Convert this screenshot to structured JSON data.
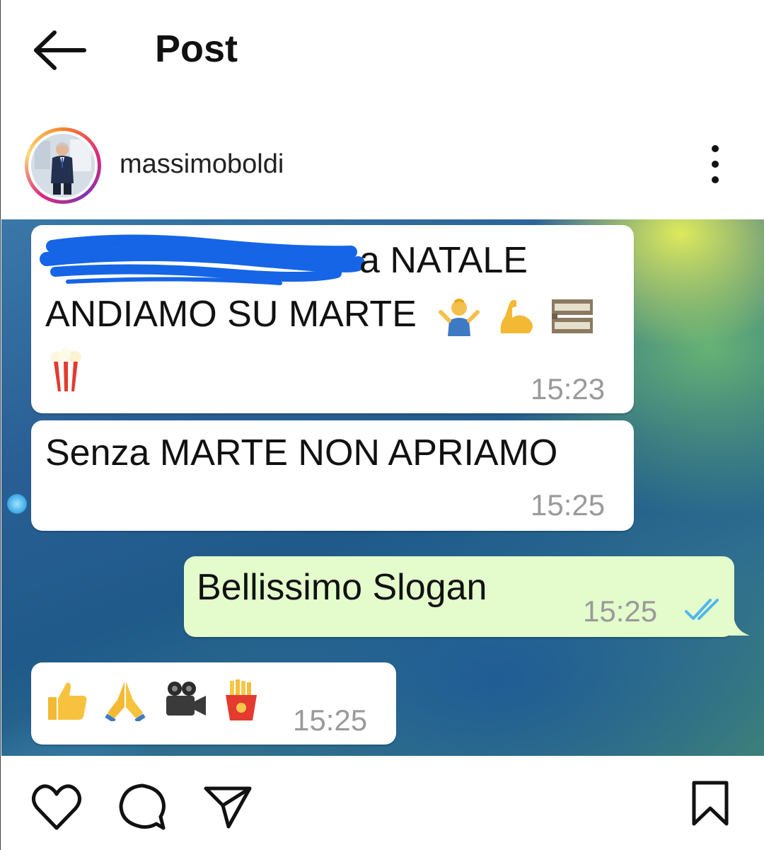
{
  "header": {
    "title": "Post",
    "back_icon": "arrow-left-icon"
  },
  "post": {
    "username": "massimoboldi",
    "more_icon": "more-vertical-icon"
  },
  "chat": {
    "messages": [
      {
        "direction": "incoming",
        "line1": "a NATALE",
        "line2": "ANDIAMO SU MARTE",
        "time": "15:23",
        "redacted": true,
        "emojis": [
          "man-shrugging-emoji",
          "flexed-biceps-emoji",
          "film-frames-emoji",
          "popcorn-emoji"
        ]
      },
      {
        "direction": "incoming",
        "text": "Senza MARTE NON APRIAMO",
        "time": "15:25"
      },
      {
        "direction": "outgoing",
        "text": "Bellissimo Slogan",
        "time": "15:25",
        "status": "read-double-check"
      },
      {
        "direction": "incoming",
        "time": "15:25",
        "emojis": [
          "thumbs-up-emoji",
          "folded-hands-emoji",
          "movie-camera-emoji",
          "french-fries-emoji"
        ]
      }
    ],
    "colors": {
      "incoming_bubble": "#ffffff",
      "outgoing_bubble": "#e4fbcc",
      "timestamp": "#9a9a9a",
      "read_ticks": "#4fb6ec",
      "redaction": "#1565e6"
    }
  },
  "actions": {
    "like_icon": "heart-icon",
    "comment_icon": "comment-icon",
    "share_icon": "send-icon",
    "save_icon": "bookmark-icon"
  }
}
